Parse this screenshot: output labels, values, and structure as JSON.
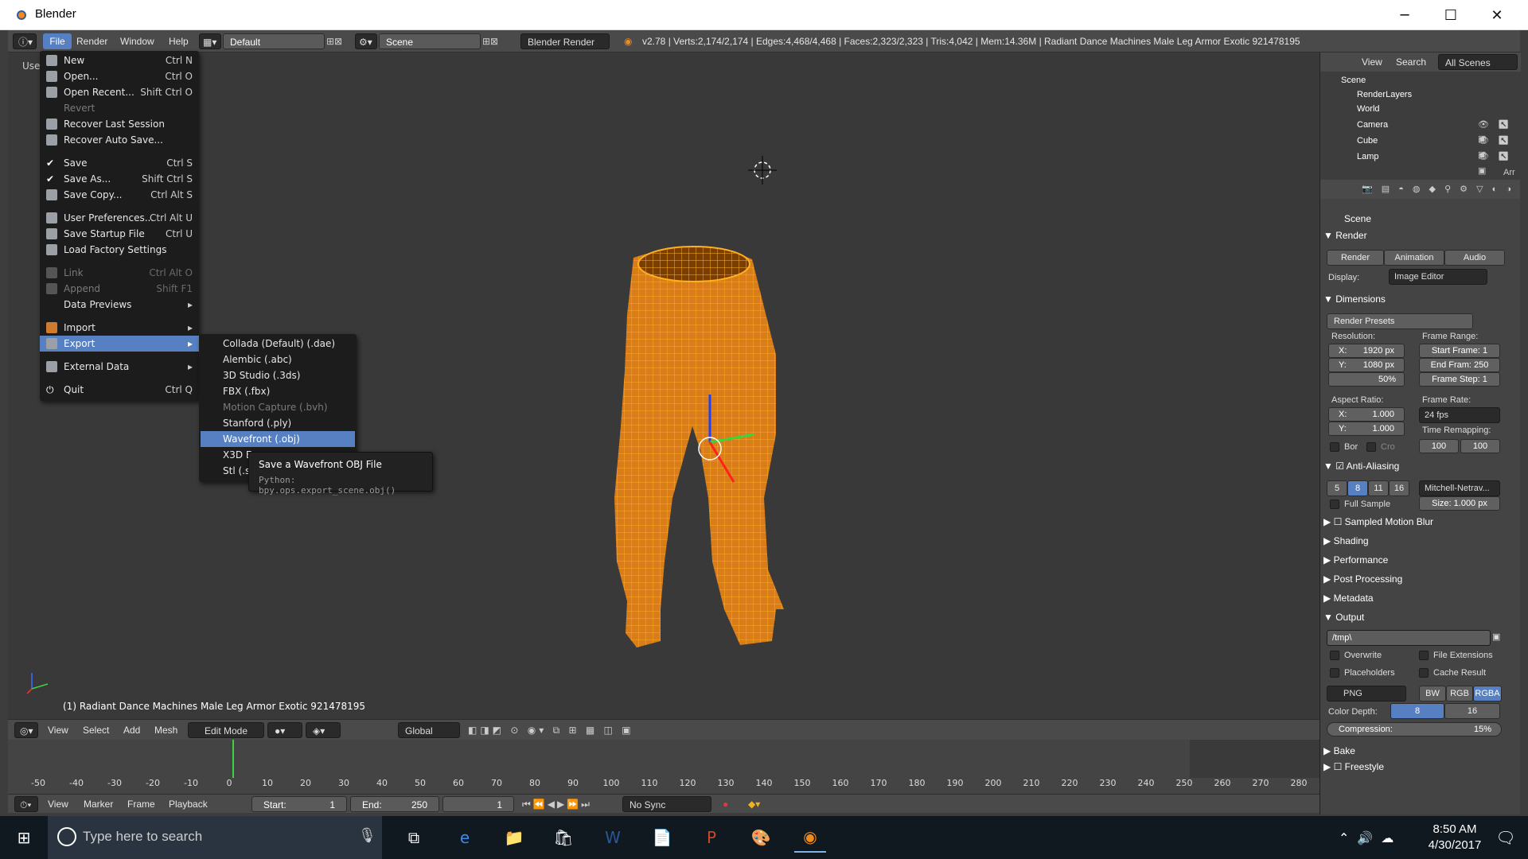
{
  "window": {
    "title": "Blender",
    "minimize": "─",
    "maximize": "☐",
    "close": "✕"
  },
  "infobar": {
    "menus": [
      "File",
      "Render",
      "Window",
      "Help"
    ],
    "layout": "Default",
    "scene": "Scene",
    "engine": "Blender Render",
    "stats": "v2.78 | Verts:2,174/2,174 | Edges:4,468/4,468 | Faces:2,323/2,323 | Tris:4,042 | Mem:14.36M | Radiant Dance Machines Male Leg Armor Exotic 921478195"
  },
  "file_menu": {
    "items": [
      {
        "label": "New",
        "shortcut": "Ctrl N",
        "enabled": true
      },
      {
        "label": "Open...",
        "shortcut": "Ctrl O",
        "enabled": true
      },
      {
        "label": "Open Recent...",
        "shortcut": "Shift Ctrl O",
        "enabled": true
      },
      {
        "label": "Revert",
        "shortcut": "",
        "enabled": false
      },
      {
        "label": "Recover Last Session",
        "shortcut": "",
        "enabled": true
      },
      {
        "label": "Recover Auto Save...",
        "shortcut": "",
        "enabled": true
      },
      {
        "label": "Save",
        "shortcut": "Ctrl S",
        "enabled": true
      },
      {
        "label": "Save As...",
        "shortcut": "Shift Ctrl S",
        "enabled": true
      },
      {
        "label": "Save Copy...",
        "shortcut": "Ctrl Alt S",
        "enabled": true
      },
      {
        "label": "User Preferences...",
        "shortcut": "Ctrl Alt U",
        "enabled": true
      },
      {
        "label": "Save Startup File",
        "shortcut": "Ctrl U",
        "enabled": true
      },
      {
        "label": "Load Factory Settings",
        "shortcut": "",
        "enabled": true
      },
      {
        "label": "Link",
        "shortcut": "Ctrl Alt O",
        "enabled": false
      },
      {
        "label": "Append",
        "shortcut": "Shift F1",
        "enabled": false
      },
      {
        "label": "Data Previews",
        "shortcut": "▸",
        "enabled": true
      },
      {
        "label": "Import",
        "shortcut": "▸",
        "enabled": true
      },
      {
        "label": "Export",
        "shortcut": "▸",
        "enabled": true
      },
      {
        "label": "External Data",
        "shortcut": "▸",
        "enabled": true
      },
      {
        "label": "Quit",
        "shortcut": "Ctrl Q",
        "enabled": true
      }
    ]
  },
  "export_menu": {
    "items": [
      {
        "label": "Collada (Default) (.dae)",
        "enabled": true
      },
      {
        "label": "Alembic (.abc)",
        "enabled": true
      },
      {
        "label": "3D Studio (.3ds)",
        "enabled": true
      },
      {
        "label": "FBX (.fbx)",
        "enabled": true
      },
      {
        "label": "Motion Capture (.bvh)",
        "enabled": false
      },
      {
        "label": "Stanford (.ply)",
        "enabled": true
      },
      {
        "label": "Wavefront (.obj)",
        "enabled": true
      },
      {
        "label": "X3D E",
        "enabled": true
      },
      {
        "label": "Stl (.st",
        "enabled": true
      }
    ]
  },
  "tooltip": {
    "title": "Save a Wavefront OBJ File",
    "python": "Python: bpy.ops.export_scene.obj()"
  },
  "viewport": {
    "label": "User",
    "object_name": "(1) Radiant Dance Machines Male Leg Armor Exotic 921478195"
  },
  "viewport_header": {
    "menus": [
      "View",
      "Select",
      "Add",
      "Mesh"
    ],
    "mode": "Edit Mode",
    "orientation": "Global"
  },
  "timeline": {
    "ticks": [
      "-50",
      "-40",
      "-30",
      "-20",
      "-10",
      "0",
      "10",
      "20",
      "30",
      "40",
      "50",
      "60",
      "70",
      "80",
      "90",
      "100",
      "110",
      "120",
      "130",
      "140",
      "150",
      "160",
      "170",
      "180",
      "190",
      "200",
      "210",
      "220",
      "230",
      "240",
      "250",
      "260",
      "270",
      "280"
    ],
    "current_frame": 0
  },
  "timeline_header": {
    "menus": [
      "View",
      "Marker",
      "Frame",
      "Playback"
    ],
    "start_label": "Start:",
    "start": "1",
    "end_label": "End:",
    "end": "250",
    "current": "1",
    "sync": "No Sync"
  },
  "outliner": {
    "tabs": [
      "View",
      "Search",
      "All Scenes"
    ],
    "items": [
      "Scene",
      "RenderLayers",
      "World",
      "Camera",
      "Cube",
      "Lamp"
    ],
    "cut": "Arr"
  },
  "properties": {
    "context": "Scene",
    "render": {
      "title": "Render",
      "buttons": [
        "Render",
        "Animation",
        "Audio"
      ],
      "display_label": "Display:",
      "display": "Image Editor"
    },
    "dimensions": {
      "title": "Dimensions",
      "presets": "Render Presets",
      "resolution_label": "Resolution:",
      "x": "X:",
      "x_val": "1920 px",
      "y": "Y:",
      "y_val": "1080 px",
      "pct": "50%",
      "frame_range_label": "Frame Range:",
      "start": "Start Frame: 1",
      "end": "End Fram: 250",
      "step": "Frame Step: 1",
      "aspect_label": "Aspect Ratio:",
      "ax": "X:",
      "ax_val": "1.000",
      "ay": "Y:",
      "ay_val": "1.000",
      "fps_label": "Frame Rate:",
      "fps": "24 fps",
      "remap_label": "Time Remapping:",
      "remap_old": "100",
      "remap_new": "100",
      "bor": "Bor",
      "cro": "Cro"
    },
    "aa": {
      "title": "Anti-Aliasing",
      "samples": [
        "5",
        "8",
        "11",
        "16"
      ],
      "filter": "Mitchell-Netrav...",
      "full": "Full Sample",
      "size": "Size: 1.000 px"
    },
    "collapsed": [
      "Sampled Motion Blur",
      "Shading",
      "Performance",
      "Post Processing",
      "Metadata"
    ],
    "output": {
      "title": "Output",
      "path": "/tmp\\",
      "overwrite": "Overwrite",
      "file_ext": "File Extensions",
      "placeholders": "Placeholders",
      "cache": "Cache Result",
      "format": "PNG",
      "bw": "BW",
      "rgb": "RGB",
      "rgba": "RGBA",
      "depth_label": "Color Depth:",
      "depth8": "8",
      "depth16": "16",
      "compression": "Compression:",
      "compression_val": "15%"
    },
    "bake": "Bake",
    "freestyle": "Freestyle"
  },
  "taskbar": {
    "search": "Type here to search",
    "time": "8:50 AM",
    "date": "4/30/2017"
  },
  "colors": {
    "accent": "#5680c2",
    "mesh": "#f0961e",
    "mesh_line": "#ffb020"
  }
}
